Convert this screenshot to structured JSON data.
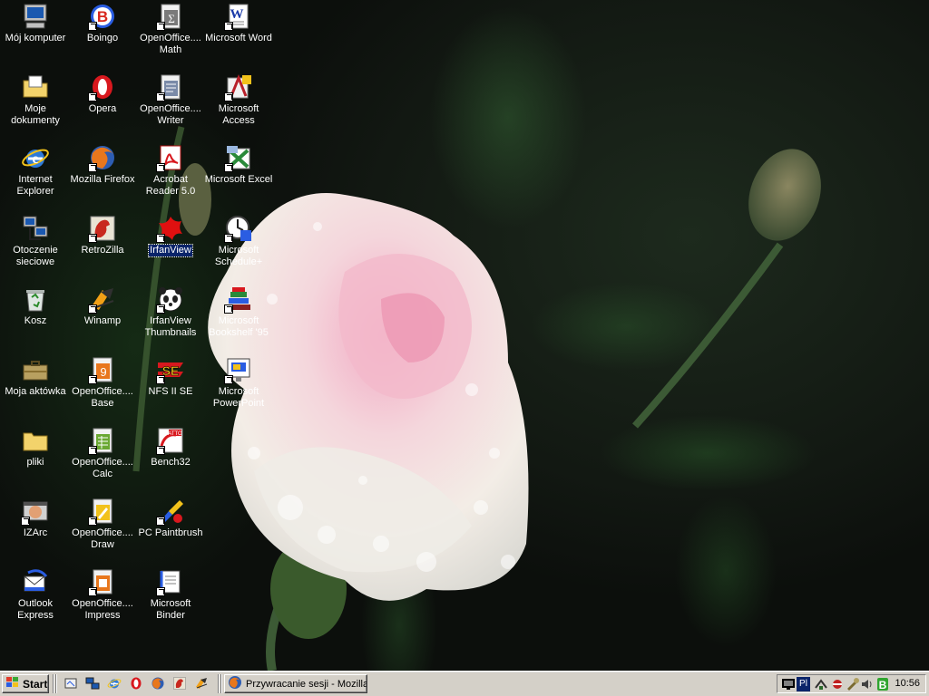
{
  "desktop": {
    "icons": [
      {
        "label": "Mój komputer",
        "icon": "my-computer-icon",
        "shortcut": false
      },
      {
        "label": "Moje dokumenty",
        "icon": "my-documents-icon",
        "shortcut": false
      },
      {
        "label": "Internet Explorer",
        "icon": "internet-explorer-icon",
        "shortcut": false
      },
      {
        "label": "Otoczenie sieciowe",
        "icon": "network-neighborhood-icon",
        "shortcut": false
      },
      {
        "label": "Kosz",
        "icon": "recycle-bin-icon",
        "shortcut": false
      },
      {
        "label": "Moja aktówka",
        "icon": "briefcase-icon",
        "shortcut": false
      },
      {
        "label": "pliki",
        "icon": "folder-icon",
        "shortcut": false
      },
      {
        "label": "IZArc",
        "icon": "izarc-icon",
        "shortcut": true
      },
      {
        "label": "Outlook Express",
        "icon": "outlook-express-icon",
        "shortcut": false
      },
      {
        "label": "Boingo",
        "icon": "boingo-icon",
        "shortcut": true
      },
      {
        "label": "Opera",
        "icon": "opera-icon",
        "shortcut": true
      },
      {
        "label": "Mozilla Firefox",
        "icon": "firefox-icon",
        "shortcut": true
      },
      {
        "label": "RetroZilla",
        "icon": "retrozilla-icon",
        "shortcut": true
      },
      {
        "label": "Winamp",
        "icon": "winamp-icon",
        "shortcut": true
      },
      {
        "label": "OpenOffice.... Base",
        "icon": "oo-base-icon",
        "shortcut": true
      },
      {
        "label": "OpenOffice.... Calc",
        "icon": "oo-calc-icon",
        "shortcut": true
      },
      {
        "label": "OpenOffice.... Draw",
        "icon": "oo-draw-icon",
        "shortcut": true
      },
      {
        "label": "OpenOffice.... Impress",
        "icon": "oo-impress-icon",
        "shortcut": true
      },
      {
        "label": "OpenOffice.... Math",
        "icon": "oo-math-icon",
        "shortcut": true
      },
      {
        "label": "OpenOffice.... Writer",
        "icon": "oo-writer-icon",
        "shortcut": true
      },
      {
        "label": "Acrobat Reader 5.0",
        "icon": "acrobat-reader-icon",
        "shortcut": true
      },
      {
        "label": "IrfanView",
        "icon": "irfanview-icon",
        "shortcut": true,
        "selected": true
      },
      {
        "label": "IrfanView Thumbnails",
        "icon": "panda-icon",
        "shortcut": true
      },
      {
        "label": "NFS II SE",
        "icon": "nfs-icon",
        "shortcut": true
      },
      {
        "label": "Bench32",
        "icon": "bench32-icon",
        "shortcut": true
      },
      {
        "label": "PC Paintbrush",
        "icon": "paintbrush-icon",
        "shortcut": true
      },
      {
        "label": "Microsoft Binder",
        "icon": "ms-binder-icon",
        "shortcut": true
      },
      {
        "label": "Microsoft Word",
        "icon": "ms-word-icon",
        "shortcut": true
      },
      {
        "label": "Microsoft Access",
        "icon": "ms-access-icon",
        "shortcut": true
      },
      {
        "label": "Microsoft Excel",
        "icon": "ms-excel-icon",
        "shortcut": true
      },
      {
        "label": "Microsoft Schedule+",
        "icon": "ms-schedule-icon",
        "shortcut": true
      },
      {
        "label": "Microsoft Bookshelf '95",
        "icon": "ms-bookshelf-icon",
        "shortcut": true
      },
      {
        "label": "Microsoft PowerPoint",
        "icon": "ms-powerpoint-icon",
        "shortcut": true
      }
    ]
  },
  "taskbar": {
    "start_label": "Start",
    "quick_launch": [
      "show-desktop-icon",
      "network-icon",
      "internet-explorer-icon",
      "opera-icon",
      "firefox-icon",
      "retrozilla-icon",
      "winamp-icon"
    ],
    "tasks": [
      {
        "label": "Przywracanie sesji - Mozilla...",
        "icon": "firefox-icon"
      }
    ],
    "tray": {
      "language": "Pl",
      "clock": "10:56"
    }
  },
  "colors": {
    "taskbar": "#d4d0c8",
    "selection": "#0a246a",
    "label_text": "#ffffff"
  }
}
